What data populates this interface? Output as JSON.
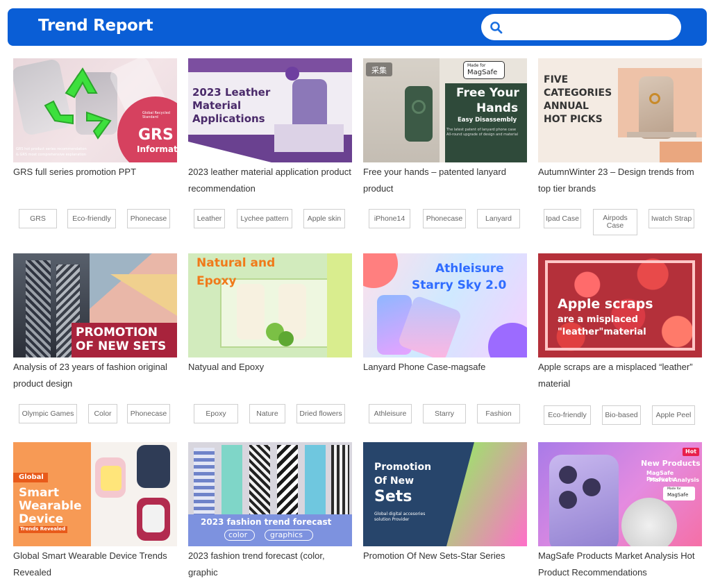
{
  "header": {
    "title": "Trend Report",
    "search_placeholder": ""
  },
  "cards": [
    {
      "title": "GRS full series promotion PPT",
      "tags": [
        "GRS",
        "Eco-friendly",
        "Phonecase"
      ],
      "thumb": {
        "big": "GRS",
        "sub": "Information",
        "badge": "Global Recycled Standard",
        "note1": "GRS hot product series recommendation",
        "note2": "& GRS most comprehensive explanation"
      }
    },
    {
      "title": "2023 leather material application product recommendation",
      "tags": [
        "Leather",
        "Lychee pattern",
        "Apple skin"
      ],
      "thumb": {
        "l1": "2023 Leather",
        "l2": "Material",
        "l3": "Applications"
      }
    },
    {
      "title": "Free your hands – patented lanyard product",
      "tags": [
        "iPhone14",
        "Phonecase",
        "Lanyard"
      ],
      "thumb": {
        "tag": "采集",
        "badge_top": "Made for",
        "badge": "MagSafe",
        "l1": "Free Your",
        "l2": "Hands",
        "l3": "Easy Disassembly",
        "note1": "The latest patent of lanyard phone case",
        "note2": "All-round upgrade of design and material"
      }
    },
    {
      "title": "AutumnWinter 23 – Design trends from top tier brands",
      "tags": [
        "Ipad Case",
        "Airpods Case",
        "Iwatch Strap"
      ],
      "thumb": {
        "l1": "FIVE",
        "l2": "CATEGORIES",
        "l3": "ANNUAL",
        "l4": "HOT PICKS"
      }
    },
    {
      "title": "Analysis of 23 years of fashion original product design",
      "tags": [
        "Olympic Games",
        "Color",
        "Phonecase"
      ],
      "thumb": {
        "l1": "PROMOTION",
        "l2": "OF NEW SETS"
      }
    },
    {
      "title": "Natyual and Epoxy",
      "tags": [
        "Epoxy",
        "Nature",
        "Dried flowers"
      ],
      "thumb": {
        "l1": "Natural and",
        "l2": "Epoxy"
      }
    },
    {
      "title": "Lanyard Phone Case-magsafe",
      "tags": [
        "Athleisure",
        "Starry",
        "Fashion"
      ],
      "thumb": {
        "l1": "Athleisure",
        "l2": "Starry Sky 2.0"
      }
    },
    {
      "title": "Apple scraps are a misplaced “leather” material",
      "tags": [
        "Eco-friendly",
        "Bio-based",
        "Apple Peel"
      ],
      "thumb": {
        "l1": "Apple scraps",
        "l2": "are a misplaced",
        "l3": "\"leather\"material"
      }
    },
    {
      "title": "Global Smart Wearable Device Trends Revealed",
      "tags": [],
      "thumb": {
        "tag": "Global",
        "l1": "Smart",
        "l2": "Wearable",
        "l3": "Device",
        "sub": "Trends Revealed"
      }
    },
    {
      "title": "2023 fashion trend forecast (color, graphic",
      "tags": [],
      "thumb": {
        "l1": "2023 fashion trend forecast",
        "p1": "color",
        "p2": "graphics"
      }
    },
    {
      "title": "Promotion Of New Sets-Star Series",
      "tags": [],
      "thumb": {
        "l1": "Promotion",
        "l2": "Of New",
        "l3": "Sets",
        "note1": "Global digital accesories",
        "note2": "solution Provider"
      }
    },
    {
      "title": "MagSafe Products Market Analysis Hot Product Recommendations",
      "tags": [],
      "thumb": {
        "hot": "Hot",
        "l1": "New Products",
        "l2": "MagSafe Products",
        "l3": "Market Analysis",
        "badge_top": "Made for",
        "badge": "MagSafe"
      }
    }
  ]
}
